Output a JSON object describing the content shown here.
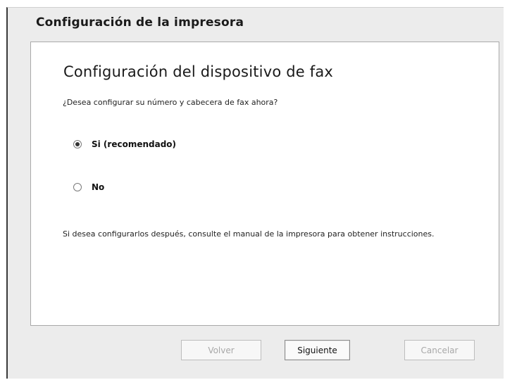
{
  "window": {
    "title": "Configuración de la impresora"
  },
  "panel": {
    "heading": "Configuración del dispositivo de fax",
    "question": "¿Desea configurar su número y cabecera de fax ahora?",
    "options": [
      {
        "label": "Si (recomendado)",
        "selected": true
      },
      {
        "label": "No",
        "selected": false
      }
    ],
    "note": "Si desea configurarlos después, consulte el manual de la impresora para obtener instrucciones."
  },
  "buttons": {
    "back_label": "Volver",
    "next_label": "Siguiente",
    "cancel_label": "Cancelar"
  }
}
